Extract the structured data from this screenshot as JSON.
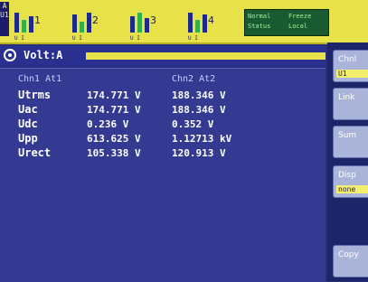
{
  "top_bar": {
    "mode_box": "A\nU1",
    "channels": [
      {
        "number": "1",
        "sub": "U    I"
      },
      {
        "number": "2",
        "sub": "U    I"
      },
      {
        "number": "3",
        "sub": "U    I"
      },
      {
        "number": "4",
        "sub": "U    I"
      }
    ],
    "status": {
      "line1_left": "Normal",
      "line1_right": "Freeze",
      "line2_left": "Status",
      "line2_right": "Local"
    }
  },
  "title": {
    "text": "Volt:A"
  },
  "table": {
    "col1_header": "Chn1 At1",
    "col2_header": "Chn2 At2",
    "rows": [
      {
        "label": "Utrms",
        "ch1": "174.771 V",
        "ch2": "188.346 V"
      },
      {
        "label": "Uac",
        "ch1": "174.771 V",
        "ch2": "188.346 V"
      },
      {
        "label": "Udc",
        "ch1": "0.236 V",
        "ch2": "0.352 V"
      },
      {
        "label": "Upp",
        "ch1": "613.625 V",
        "ch2": "1.12713 kV"
      },
      {
        "label": "Urect",
        "ch1": "105.338 V",
        "ch2": "120.913 V"
      }
    ]
  },
  "softkeys": [
    {
      "label": "Chnl",
      "value": "U1"
    },
    {
      "label": "Link",
      "value": ""
    },
    {
      "label": "Sum",
      "value": ""
    },
    {
      "label": "Disp",
      "value": "none"
    },
    {
      "label": "Copy",
      "value": ""
    }
  ],
  "colors": {
    "topbar": "#e8e24a",
    "panel": "#343a92",
    "accent_yellow": "#f2ee70"
  }
}
